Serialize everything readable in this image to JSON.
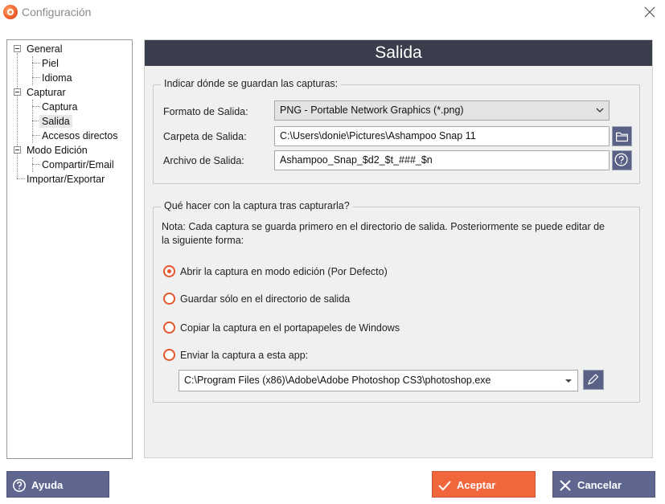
{
  "window": {
    "title": "Configuración"
  },
  "tree": {
    "items": [
      {
        "label": "General"
      },
      {
        "label": "Piel"
      },
      {
        "label": "Idioma"
      },
      {
        "label": "Capturar"
      },
      {
        "label": "Captura"
      },
      {
        "label": "Salida"
      },
      {
        "label": "Accesos directos"
      },
      {
        "label": "Modo Edición"
      },
      {
        "label": "Compartir/Email"
      },
      {
        "label": "Importar/Exportar"
      }
    ],
    "selected": "Salida"
  },
  "main": {
    "header": "Salida",
    "output_group": {
      "legend": "Indicar dónde se guardan las capturas:",
      "format_label": "Formato de Salida:",
      "format_value": "PNG - Portable Network Graphics (*.png)",
      "folder_label": "Carpeta de Salida:",
      "folder_value": "C:\\Users\\donie\\Pictures\\Ashampoo Snap 11",
      "file_label": "Archivo de Salida:",
      "file_value": "Ashampoo_Snap_$d2_$t_###_$n"
    },
    "after_group": {
      "legend": "Qué hacer con la captura tras capturarla?",
      "note_line1": "Nota: Cada captura se guarda primero en el directorio de salida. Posteriormente se puede editar de",
      "note_line2": "la siguiente forma:",
      "options": [
        {
          "label": "Abrir la captura en modo edición (Por Defecto)",
          "checked": true
        },
        {
          "label": "Guardar sólo en el directorio de salida",
          "checked": false
        },
        {
          "label": "Copiar la captura en el portapapeles de Windows",
          "checked": false
        },
        {
          "label": "Enviar la captura a esta app:",
          "checked": false
        }
      ],
      "app_path": "C:\\Program Files (x86)\\Adobe\\Adobe Photoshop CS3\\photoshop.exe"
    }
  },
  "footer": {
    "help_label": "Ayuda",
    "accept_label": "Aceptar",
    "cancel_label": "Cancelar"
  },
  "colors": {
    "header_bg": "#3a3d4b",
    "accent_orange": "#f1663d",
    "button_blue": "#5f6791"
  }
}
